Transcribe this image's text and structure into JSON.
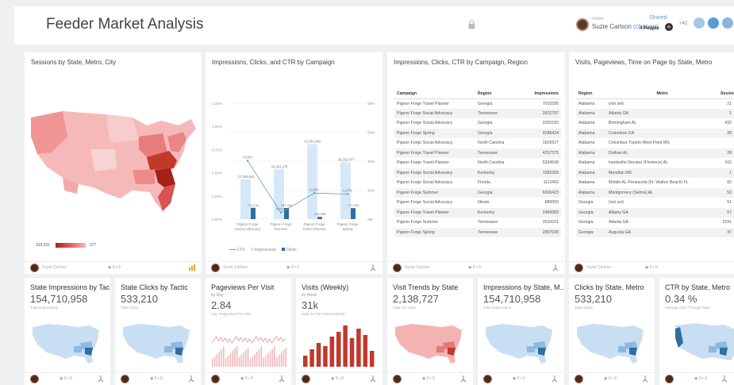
{
  "header": {
    "title": "Feeder Market Analysis",
    "owner_label": "Owner",
    "owner_name": "Suzie Carlson",
    "owner_change": "(change)",
    "shared_label": "Shared",
    "shared_count": "4 People",
    "viewers_extra": "+42"
  },
  "colors": {
    "accent": "#5a9bd5",
    "red": "#c0392b",
    "blue": "#2f6e9e",
    "light_blue": "#c8def3"
  },
  "cards": {
    "sessions": {
      "title": "Sessions by State, Metro, City",
      "legend_max": "319,531",
      "legend_min": "377"
    },
    "impressions_chart": {
      "title": "Impressions, Clicks, and CTR by Campaign",
      "legend": [
        "CTR",
        "Impressions",
        "Clicks"
      ]
    },
    "campaign_table": {
      "title": "Impressions, Clicks, CTR by Campaign, Region",
      "columns": [
        "Campaign",
        "Region",
        "Impressions"
      ],
      "rows": [
        [
          "Pigeon Forge Travel Planner",
          "Georgia",
          "7010395"
        ],
        [
          "Pigeon Forge Social Advocacy",
          "Tennessee",
          "2822787"
        ],
        [
          "Pigeon Forge Social Advocacy",
          "Georgia",
          "2250150"
        ],
        [
          "Pigeon Forge Spring",
          "Georgia",
          "9286424"
        ],
        [
          "Pigeon Forge Social Advocacy",
          "North Carolina",
          "1826527"
        ],
        [
          "Pigeon Forge Travel Planner",
          "Tennessee",
          "4257375"
        ],
        [
          "Pigeon Forge Travel Planner",
          "North Carolina",
          "5334549"
        ],
        [
          "Pigeon Forge Social Advocacy",
          "Kentucky",
          "1982369"
        ],
        [
          "Pigeon Forge Social Advocacy",
          "Florida",
          "1113402"
        ],
        [
          "Pigeon Forge Summer",
          "Georgia",
          "6936423"
        ],
        [
          "Pigeon Forge Social Advocacy",
          "Illinois",
          "880050"
        ],
        [
          "Pigeon Forge Travel Planner",
          "Kentucky",
          "2460083"
        ],
        [
          "Pigeon Forge Summer",
          "Tennessee",
          "2634101"
        ],
        [
          "Pigeon Forge Spring",
          "Tennessee",
          "2807028"
        ]
      ]
    },
    "visits_table": {
      "title": "Visits, Pageviews, Time on Page by State, Metro",
      "columns": [
        "Region",
        "Metro",
        "Sessio"
      ],
      "rows": [
        [
          "Alabama",
          "(not set)",
          "21"
        ],
        [
          "Alabama",
          "Atlanta GA",
          "1"
        ],
        [
          "Alabama",
          "Birmingham AL",
          "432"
        ],
        [
          "Alabama",
          "Columbus GA",
          "28"
        ],
        [
          "Alabama",
          "Columbus-Tupelo-West Point MS",
          ""
        ],
        [
          "Alabama",
          "Dothan AL",
          "28"
        ],
        [
          "Alabama",
          "Huntsville-Decatur (Florence) AL",
          "162"
        ],
        [
          "Alabama",
          "Meridian MS",
          "1"
        ],
        [
          "Alabama",
          "Mobile AL-Pensacola (Ft. Walton Beach) FL",
          "82"
        ],
        [
          "Alabama",
          "Montgomery (Selma) AL",
          "52"
        ],
        [
          "Georgia",
          "(not set)",
          "61"
        ],
        [
          "Georgia",
          "Albany GA",
          "57"
        ],
        [
          "Georgia",
          "Atlanta GA",
          "2191"
        ],
        [
          "Georgia",
          "Augusta GA",
          "47"
        ]
      ]
    },
    "metrics": [
      {
        "title": "State Impressions by Tac...",
        "sub": "",
        "value": "154,710,958",
        "caption": "Total Impressions"
      },
      {
        "title": "State Clicks by Tactic",
        "sub": "",
        "value": "533,210",
        "caption": "Total Clicks"
      },
      {
        "title": "Pageviews Per Visit",
        "sub": "by Day",
        "value": "2.84",
        "caption": "Avg. Pageviews Per Visit"
      },
      {
        "title": "Visits (Weekly)",
        "sub": "by Week",
        "value": "31k",
        "caption": "Visits for the Current Month"
      },
      {
        "title": "Visit Trends by State",
        "sub": "",
        "value": "2,138,727",
        "caption": "Total US Visits"
      },
      {
        "title": "Impressions by State, M...",
        "sub": "",
        "value": "154,710,958",
        "caption": "Total Impressions"
      },
      {
        "title": "Clicks by State, Metro",
        "sub": "",
        "value": "533,210",
        "caption": "Total Clicks"
      },
      {
        "title": "CTR by State, Metro",
        "sub": "",
        "value": "0.34 %",
        "caption": "Average Click Through Rate"
      }
    ],
    "footer": {
      "user": "Suzie Carlson",
      "views": "0",
      "comments": "0"
    }
  },
  "chart_data": {
    "type": "bar",
    "categories": [
      "Pigeon Forge Social Advocacy",
      "Pigeon Forge Summer",
      "Pigeon Forge Travel Planner",
      "Pigeon Forge Spring"
    ],
    "series": [
      {
        "name": "Impressions",
        "values": [
          27359924,
          34262275,
          51651842,
          39262477
        ],
        "labels": [
          "27,359,924",
          "34,262,275",
          "51,651,842",
          "39,262,477"
        ]
      },
      {
        "name": "Clicks",
        "values": [
          779134,
          767344,
          154088,
          757059
        ],
        "labels": [
          "779,134",
          "767,344",
          "154,088",
          "757,059"
        ]
      },
      {
        "name": "CTR",
        "values": [
          0.63,
          0.07,
          0.28,
          0.27
        ],
        "labels": [
          "0.63%",
          "0.07%",
          "0.28%",
          "0.27%"
        ]
      }
    ],
    "y_left_ticks": [
      "0.00%",
      "0.25%",
      "0.50%",
      "0.75%",
      "1.00%",
      "1.25%"
    ],
    "y_right_ticks": [
      "0M",
      "20M",
      "40M",
      "60M",
      "80M"
    ],
    "ylim": [
      0,
      80000000
    ]
  }
}
